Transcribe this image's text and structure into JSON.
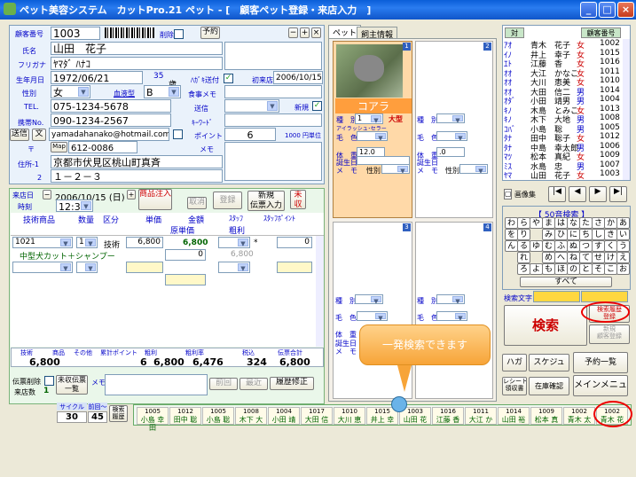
{
  "title": "ペット美容システム　カットPro.21 ペット - [　顧客ペット登録・来店入力　]",
  "customer": {
    "no_label": "顧客番号",
    "no": "1003",
    "delete_label": "削除",
    "yoyaku": "予約",
    "name_label": "氏名",
    "name": "山田　花子",
    "furigana_label": "フリガナ",
    "furigana": "ﾔﾏﾀﾞ ﾊﾅｺ",
    "birth_label": "生年月日",
    "birth": "1972/06/21",
    "age": "35",
    "age_unit": "歳",
    "hagaki_label": "ﾊｶﾞｷ送付",
    "first_visit_label": "初来店",
    "first_visit": "2006/10/15",
    "sex_label": "性別",
    "sex": "女",
    "blood_label": "血液型",
    "blood": "B",
    "tel_label": "TEL.",
    "tel": "075-1234-5678",
    "sousin_label": "送信",
    "shinki_label": "新規",
    "mobile_label": "携帯No.",
    "mobile": "090-1234-2567",
    "keyword_label": "ｷｰﾜｰﾄﾞ",
    "send_btn": "送信",
    "mail_btn": "文",
    "email": "yamadahanako@hotmail.com",
    "point_label": "ポイント",
    "point": "6",
    "point_rate": "1000 円単位",
    "zip_label": "〒",
    "map_btn": "Map",
    "zip": "612-0086",
    "memo_label": "メモ",
    "addr1_label": "住所-1",
    "addr1": "京都市伏見区桃山町真斉",
    "addr2_label": "2",
    "addr2": "１－２－３",
    "food_memo_label": "食事メモ"
  },
  "visit": {
    "date_label": "来店日",
    "date": "2006/10/15 (日)",
    "time_label": "時刻",
    "time": "12:30",
    "shohin_btn": "商品注入",
    "cancel_btn": "取消",
    "touroku_btn": "登録",
    "new_slip_btn": "新規\n伝票入力",
    "unpaid_btn": "未収",
    "headers": [
      "技術商品",
      "数量",
      "区分",
      "単価",
      "金額",
      "ｽﾀｯﾌ",
      "ｽﾀｯﾌﾎﾟｲﾝﾄ",
      "原単価",
      "粗利"
    ],
    "row1": {
      "code": "1021",
      "qty": "1",
      "kubun": "技術",
      "price": "6,800",
      "amount": "6,800",
      "cost": "0",
      "staff_point": "0"
    },
    "row1_name": "中型犬カット＋シャンプー",
    "row1_gross": "6,800",
    "totals_labels": [
      "技術",
      "商品",
      "その他",
      "累計ポイント",
      "粗利",
      "粗利率",
      "税込",
      "伝票合計"
    ],
    "total_amount": "6,800",
    "total_point": "6",
    "total_sum": "6,800",
    "gross": "6,476",
    "tax": "324",
    "slip_total": "6,800",
    "slip_delete": "伝票削除",
    "visits_label": "来店数",
    "visits": "1",
    "unpaid_list": "未収伝票\n一覧",
    "memo_label": "メモ",
    "prev_btn": "前回",
    "latest_btn": "最近",
    "history_btn": "履歴修正"
  },
  "pet": {
    "tab_pet": "ペット",
    "tab_info": "飼主情報",
    "name": "コアラ",
    "slot1": "1",
    "slot2": "2",
    "slot3": "3",
    "slot4": "4",
    "breed_label": "種　別",
    "breed": "1",
    "size": "大型",
    "note": "アイラッシュ･セラー",
    "color_label": "毛　色",
    "weight_label": "体　重",
    "weight": "12.0",
    "birthday_label": "誕生日",
    "memo_label": "メ　モ",
    "sex_label": "性別",
    "weight2": ".0"
  },
  "search": {
    "header_labels": [
      "対",
      "顧客番号"
    ],
    "rows": [
      [
        "ｱｵ",
        "青木　花子",
        "女",
        "1002"
      ],
      [
        "ｲﾉ",
        "井上　幸子",
        "女",
        "1015"
      ],
      [
        "ｴﾄ",
        "江藤　香",
        "女",
        "1016"
      ],
      [
        "ｵｵ",
        "大江　かなこ",
        "女",
        "1011"
      ],
      [
        "ｵｵ",
        "大川　恵美",
        "女",
        "1010"
      ],
      [
        "ｵｵ",
        "大田　信二",
        "男",
        "1014"
      ],
      [
        "ｵﾀﾞ",
        "小田　靖男",
        "男",
        "1004"
      ],
      [
        "ｷﾉ",
        "木島　とみこ",
        "女",
        "1013"
      ],
      [
        "ｷﾉ",
        "木下　大地",
        "男",
        "1008"
      ],
      [
        "ｺﾊﾞ",
        "小島　聡",
        "男",
        "1005"
      ],
      [
        "ﾀﾅ",
        "田中　聡子",
        "女",
        "1012"
      ],
      [
        "ﾀﾅ",
        "中島　幸太郎",
        "男",
        "1006"
      ],
      [
        "ﾏﾂ",
        "松本　真紀",
        "女",
        "1009"
      ],
      [
        "ﾐｽ",
        "水島　忠",
        "男",
        "1007"
      ],
      [
        "ﾔﾏ",
        "山田　花子",
        "女",
        "1003"
      ]
    ],
    "image_label": "画像集",
    "kana_title": "【 50音検索 】",
    "kana": [
      "わ",
      "ら",
      "や",
      "ま",
      "は",
      "な",
      "た",
      "さ",
      "か",
      "あ",
      "を",
      "り",
      "",
      "み",
      "ひ",
      "に",
      "ち",
      "し",
      "き",
      "い",
      "ん",
      "る",
      "ゆ",
      "む",
      "ふ",
      "ぬ",
      "つ",
      "す",
      "く",
      "う",
      "",
      "れ",
      "",
      "め",
      "へ",
      "ね",
      "て",
      "せ",
      "け",
      "え",
      "",
      "ろ",
      "よ",
      "も",
      "ほ",
      "の",
      "と",
      "そ",
      "こ",
      "お"
    ],
    "all_btn": "すべて",
    "search_char_label": "検索文字",
    "search_btn": "検索",
    "history_search_btn": "検索履歴\n登録",
    "new_reg_btn": "新規\n顧客登録"
  },
  "bottom": {
    "hagaki": "ハガキ",
    "schedule": "スケジュール",
    "yoyaku_list": "予約一覧",
    "receipt": "レシート\n領収書",
    "zaiko": "在庫確認",
    "menu": "メインメニュー"
  },
  "cycle": {
    "cycle_label": "サイクル",
    "prev_label": "前回～",
    "cycle": "30",
    "prev": "45",
    "history_btn": "検索\n履歴"
  },
  "history": [
    [
      "1005",
      "小島 幸田"
    ],
    [
      "1012",
      "田中 聡"
    ],
    [
      "1005",
      "小島 聡"
    ],
    [
      "1008",
      "木下 大"
    ],
    [
      "1004",
      "小田 靖"
    ],
    [
      "1017",
      "大田 信"
    ],
    [
      "1010",
      "大川 恵"
    ],
    [
      "1015",
      "井上 幸"
    ],
    [
      "1003",
      "山田 花"
    ],
    [
      "1016",
      "江藤 香"
    ],
    [
      "1011",
      "大江 か"
    ],
    [
      "1014",
      "山田 裕"
    ],
    [
      "1009",
      "松本 真"
    ],
    [
      "1002",
      "青木 太"
    ],
    [
      "1002",
      "青木 花"
    ]
  ],
  "balloon": "一発検索できます"
}
